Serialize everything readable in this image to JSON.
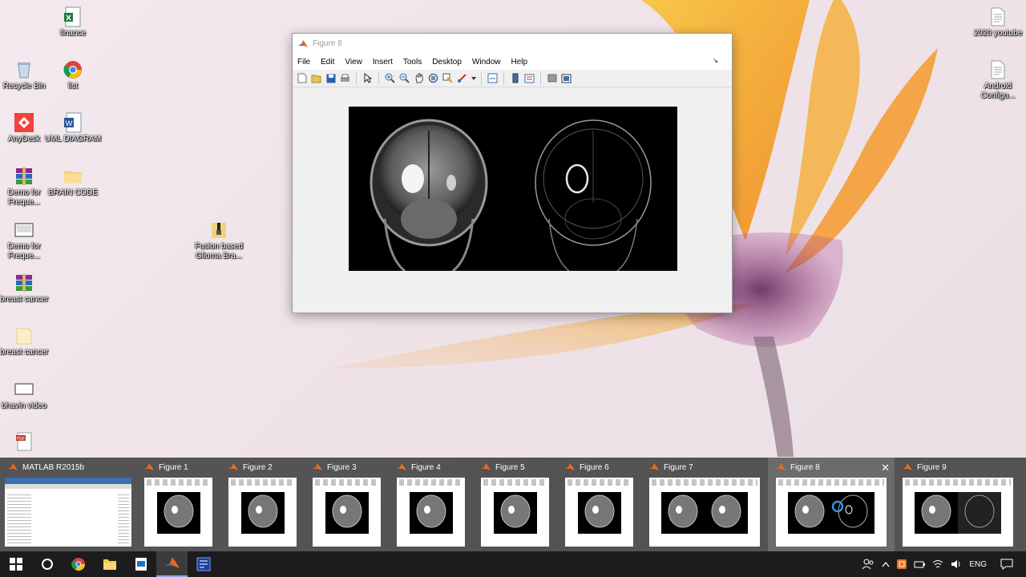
{
  "desktop": {
    "icons": [
      {
        "label": "finance",
        "icon": "spreadsheet-icon"
      },
      {
        "label": "Recycle Bin",
        "icon": "recycle-bin-icon"
      },
      {
        "label": "list",
        "icon": "chrome-icon"
      },
      {
        "label": "AnyDesk",
        "icon": "anydesk-icon"
      },
      {
        "label": "UML DIAGRAM",
        "icon": "word-doc-icon"
      },
      {
        "label": "Demo for Freque...",
        "icon": "winrar-icon"
      },
      {
        "label": "BRAIN CODE",
        "icon": "folder-icon"
      },
      {
        "label": "Demo for Freque...",
        "icon": "video-file-icon"
      },
      {
        "label": "Fusion based Glioma Bra...",
        "icon": "zip-folder-icon"
      },
      {
        "label": "breast cancer",
        "icon": "winrar-icon"
      },
      {
        "label": "breast cancer",
        "icon": "folder-icon"
      },
      {
        "label": "bhavin video",
        "icon": "video-file-icon"
      },
      {
        "label": "2020 youtube",
        "icon": "text-file-icon"
      },
      {
        "label": "Android Configu...",
        "icon": "text-file-icon"
      }
    ]
  },
  "figure_window": {
    "title": "Figure 8",
    "menu": [
      "File",
      "Edit",
      "View",
      "Insert",
      "Tools",
      "Desktop",
      "Window",
      "Help"
    ]
  },
  "previews": [
    {
      "title": "MATLAB R2015b"
    },
    {
      "title": "Figure 1"
    },
    {
      "title": "Figure 2"
    },
    {
      "title": "Figure 3"
    },
    {
      "title": "Figure 4"
    },
    {
      "title": "Figure 5"
    },
    {
      "title": "Figure 6"
    },
    {
      "title": "Figure 7"
    },
    {
      "title": "Figure 8",
      "active": true
    },
    {
      "title": "Figure 9"
    }
  ],
  "tray": {
    "language": "ENG"
  },
  "colors": {
    "taskbar": "#1c1c1e",
    "matlab_orange": "#e86a1f",
    "flower_orange": "#f4a21c",
    "flower_purple": "#7a2e6e"
  }
}
